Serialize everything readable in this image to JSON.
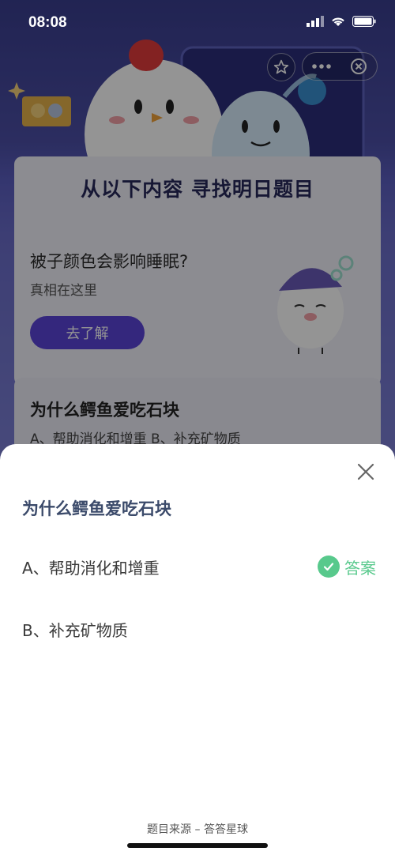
{
  "status_bar": {
    "time": "08:08"
  },
  "header": {
    "banner_title": "从以下内容 寻找明日题目"
  },
  "card1": {
    "question": "被子颜色会影响睡眠?",
    "subtitle": "真相在这里",
    "button_label": "去了解"
  },
  "card2": {
    "question": "为什么鳄鱼爱吃石块",
    "options_preview": "A、帮助消化和增重     B、补充矿物质"
  },
  "sheet": {
    "title": "为什么鳄鱼爱吃石块",
    "options": [
      {
        "label": "A、帮助消化和增重",
        "is_answer": true
      },
      {
        "label": "B、补充矿物质",
        "is_answer": false
      }
    ],
    "answer_label": "答案",
    "source": "题目来源 – 答答星球"
  },
  "colors": {
    "accent_green": "#58c98c",
    "button_purple": "#5a44d8",
    "title_text": "#3b4a6a"
  }
}
